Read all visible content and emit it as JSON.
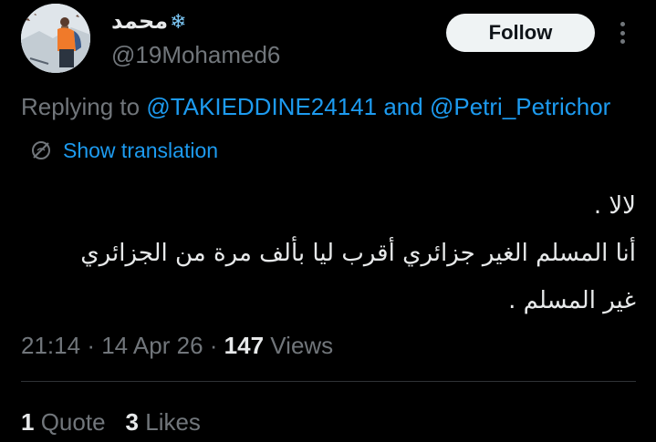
{
  "author": {
    "display_name": "محمد",
    "name_emoji_icon": "snowflake-icon",
    "handle": "@19Mohamed6",
    "avatar_icon": "profile-photo-icon"
  },
  "header": {
    "follow_label": "Follow",
    "more_icon": "more-vertical-icon"
  },
  "reply": {
    "prefix": "Replying to",
    "mention_1": "@TAKIEDDINE24141",
    "connector": "and",
    "mention_2": "@Petri_Petrichor"
  },
  "translation": {
    "icon": "globe-icon",
    "label": "Show translation"
  },
  "tweet": {
    "lines": [
      "لالا .",
      "أنا المسلم الغير جزائري أقرب ليا بألف مرة من الجزائري",
      "غير المسلم ."
    ]
  },
  "meta": {
    "time": "21:14",
    "separator": "·",
    "date": "14 Apr 26",
    "views_count": "147",
    "views_label": "Views"
  },
  "stats": {
    "quotes_count": "1",
    "quotes_label": "Quote",
    "likes_count": "3",
    "likes_label": "Likes"
  },
  "colors": {
    "background": "#000000",
    "text_primary": "#e7e9ea",
    "text_secondary": "#71767b",
    "link": "#1d9bf0",
    "follow_bg": "#eff3f4",
    "divider": "#2f3336"
  }
}
